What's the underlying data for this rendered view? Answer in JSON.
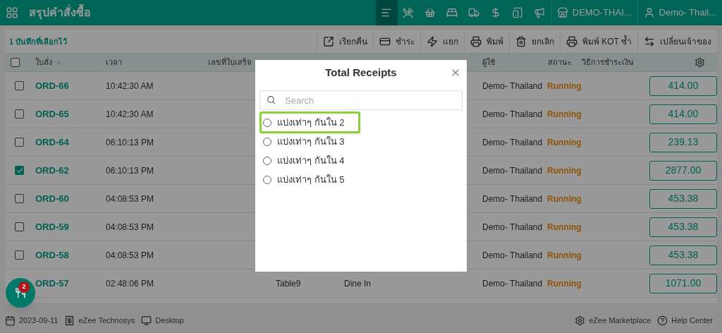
{
  "app_bar": {
    "title": "สรุปคำสั่งซื้อ",
    "nav_icons": [
      {
        "kind": "sort",
        "selected": true
      },
      {
        "kind": "dining",
        "selected": false
      },
      {
        "kind": "basket",
        "selected": false
      },
      {
        "kind": "bed",
        "selected": false
      },
      {
        "kind": "truck",
        "selected": false
      },
      {
        "kind": "dollar",
        "selected": false
      },
      {
        "kind": "tablet",
        "selected": false
      },
      {
        "kind": "megaphone",
        "selected": false
      }
    ],
    "outlet": "DEMO-THAI...",
    "user": "Demo- Thail..."
  },
  "toolbar": {
    "selection_count": "1 บันทึกที่เลือกไว้",
    "actions": [
      {
        "kind": "recall",
        "label": "เรียกคืน"
      },
      {
        "kind": "pay",
        "label": "ชำระ"
      },
      {
        "kind": "split",
        "label": "แยก"
      },
      {
        "kind": "print",
        "label": "พิมพ์"
      },
      {
        "kind": "cancel",
        "label": "ยกเลิก"
      },
      {
        "kind": "kot",
        "label": "พิมพ์ KOT ซ้ำ"
      },
      {
        "kind": "transfer",
        "label": "เปลี่ยนเจ้าของ"
      }
    ]
  },
  "table": {
    "select_all": {
      "checked": false
    },
    "columns": [
      "ใบสั่ง",
      "เวลา",
      "เลขที่ใบเสร็จ",
      "ผู้ใช้",
      "สถานะ",
      "วิธีการชำระเงิน"
    ],
    "rows": [
      {
        "checked": false,
        "order": "ORD-66",
        "time": "10:42:30 AM",
        "user": "Demo- Thailand",
        "status": "Running",
        "amount": "414.00"
      },
      {
        "checked": false,
        "order": "ORD-65",
        "time": "10:42:30 AM",
        "user": "Demo- Thailand",
        "status": "Running",
        "amount": "414.00"
      },
      {
        "checked": false,
        "order": "ORD-64",
        "time": "06:10:13 PM",
        "user": "Demo- Thailand",
        "status": "Running",
        "amount": "239.13"
      },
      {
        "checked": true,
        "order": "ORD-62",
        "time": "06:10:13 PM",
        "user": "Demo- Thailand",
        "status": "Running",
        "amount": "2877.00"
      },
      {
        "checked": false,
        "order": "ORD-60",
        "time": "04:08:53 PM",
        "user": "Demo- Thailand",
        "status": "Running",
        "amount": "453.38"
      },
      {
        "checked": false,
        "order": "ORD-59",
        "time": "04:08:53 PM",
        "user": "Demo- Thailand",
        "status": "Running",
        "amount": "453.38"
      },
      {
        "checked": false,
        "order": "ORD-58",
        "time": "04:08:53 PM",
        "user": "Demo- Thailand",
        "status": "Running",
        "amount": "453.38"
      },
      {
        "order": "ORD-57",
        "time": "02:48:06 PM",
        "table": "Table9",
        "type": "Dine In",
        "user": "Demo- Thailand",
        "status": "Running",
        "amount": "1071.00"
      }
    ]
  },
  "fab": {
    "badge": "2"
  },
  "footer": {
    "date": "2023-09-11",
    "company": "eZee Technosys",
    "device": "Desktop",
    "marketplace": "eZee Marketplace",
    "help": "Help Center"
  },
  "dialog": {
    "title": "Total Receipts",
    "search": {
      "placeholder": "Search"
    },
    "options": [
      {
        "label": "แบ่งเท่าๆ กันใน 2",
        "selected": false,
        "highlighted": true
      },
      {
        "label": "แบ่งเท่าๆ กันใน 3",
        "selected": false,
        "highlighted": false
      },
      {
        "label": "แบ่งเท่าๆ กันใน 4",
        "selected": false,
        "highlighted": false
      },
      {
        "label": "แบ่งเท่าๆ กันใน 5",
        "selected": false,
        "highlighted": false
      }
    ]
  }
}
